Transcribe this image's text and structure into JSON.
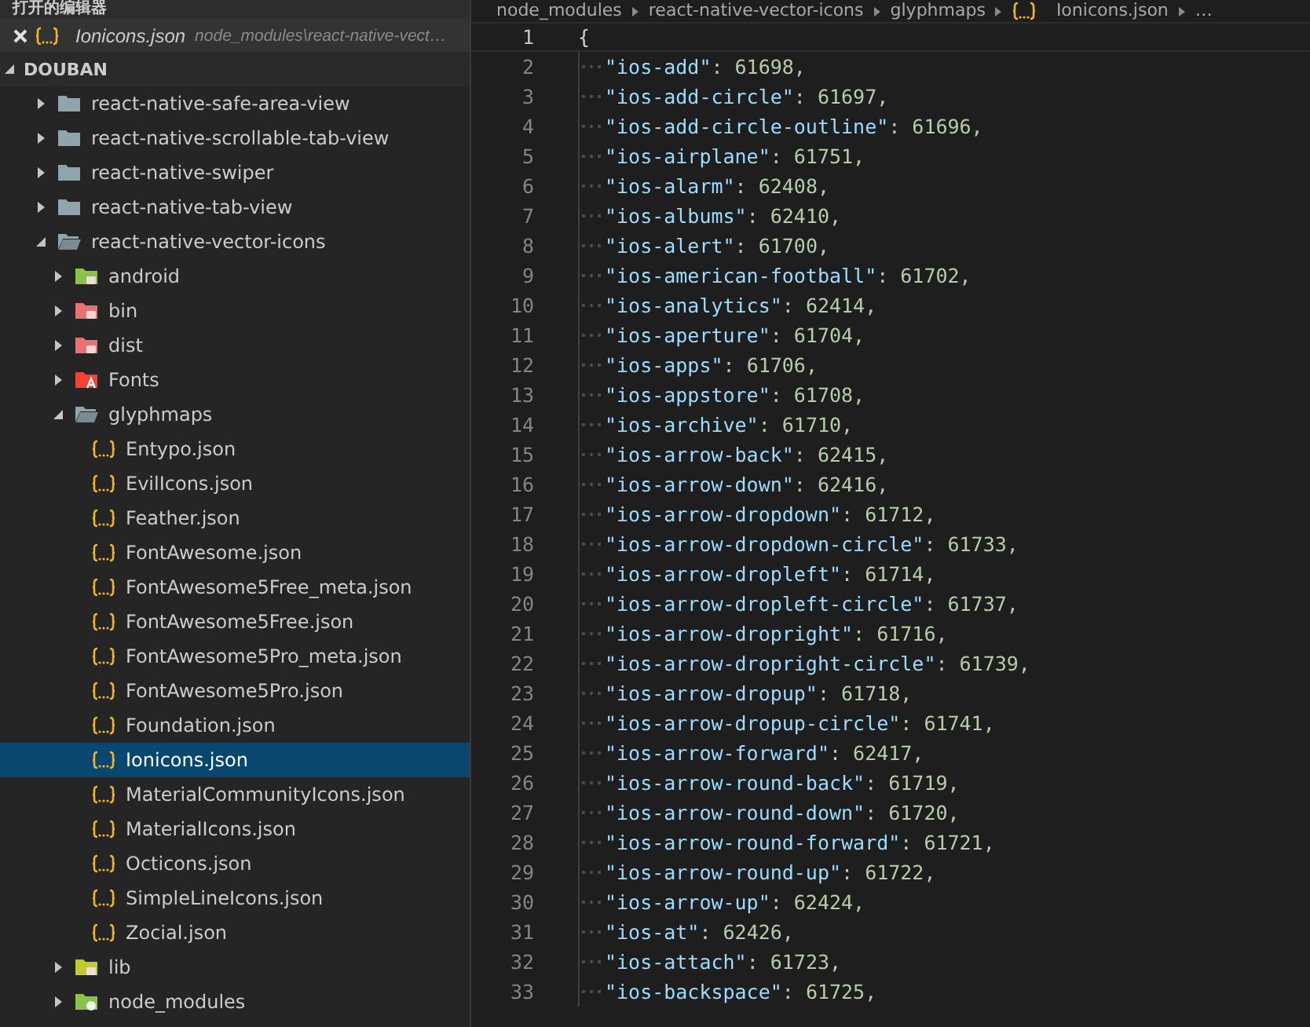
{
  "sidebar": {
    "open_editors_title": "打开的编辑器",
    "open_editors": [
      {
        "name": "Ionicons.json",
        "path": "node_modules\\react-native-vect…"
      }
    ],
    "project": "DOUBAN",
    "tree": [
      {
        "name": "react-native-safe-area-view",
        "kind": "folder",
        "expanded": false
      },
      {
        "name": "react-native-scrollable-tab-view",
        "kind": "folder",
        "expanded": false
      },
      {
        "name": "react-native-swiper",
        "kind": "folder",
        "expanded": false
      },
      {
        "name": "react-native-tab-view",
        "kind": "folder",
        "expanded": false
      },
      {
        "name": "react-native-vector-icons",
        "kind": "folder",
        "expanded": true,
        "children": [
          {
            "name": "android",
            "kind": "android",
            "expanded": false
          },
          {
            "name": "bin",
            "kind": "bin",
            "expanded": false
          },
          {
            "name": "dist",
            "kind": "dist",
            "expanded": false
          },
          {
            "name": "Fonts",
            "kind": "fonts",
            "expanded": false
          },
          {
            "name": "glyphmaps",
            "kind": "folder",
            "expanded": true,
            "children": [
              {
                "name": "Entypo.json",
                "kind": "json",
                "selected": false
              },
              {
                "name": "EvilIcons.json",
                "kind": "json",
                "selected": false
              },
              {
                "name": "Feather.json",
                "kind": "json",
                "selected": false
              },
              {
                "name": "FontAwesome.json",
                "kind": "json",
                "selected": false
              },
              {
                "name": "FontAwesome5Free_meta.json",
                "kind": "json",
                "selected": false
              },
              {
                "name": "FontAwesome5Free.json",
                "kind": "json",
                "selected": false
              },
              {
                "name": "FontAwesome5Pro_meta.json",
                "kind": "json",
                "selected": false
              },
              {
                "name": "FontAwesome5Pro.json",
                "kind": "json",
                "selected": false
              },
              {
                "name": "Foundation.json",
                "kind": "json",
                "selected": false
              },
              {
                "name": "Ionicons.json",
                "kind": "json",
                "selected": true
              },
              {
                "name": "MaterialCommunityIcons.json",
                "kind": "json",
                "selected": false
              },
              {
                "name": "MaterialIcons.json",
                "kind": "json",
                "selected": false
              },
              {
                "name": "Octicons.json",
                "kind": "json",
                "selected": false
              },
              {
                "name": "SimpleLineIcons.json",
                "kind": "json",
                "selected": false
              },
              {
                "name": "Zocial.json",
                "kind": "json",
                "selected": false
              }
            ]
          },
          {
            "name": "lib",
            "kind": "lib",
            "expanded": false
          },
          {
            "name": "node_modules",
            "kind": "node",
            "expanded": false
          }
        ]
      }
    ]
  },
  "breadcrumb": [
    "node_modules",
    "react-native-vector-icons",
    "glyphmaps",
    "Ionicons.json",
    "…"
  ],
  "editor": {
    "lines": [
      {
        "number": "1",
        "text": "{"
      },
      {
        "number": "2",
        "key": "\"ios-add\"",
        "value": ": 61698,"
      },
      {
        "number": "3",
        "key": "\"ios-add-circle\"",
        "value": ": 61697,"
      },
      {
        "number": "4",
        "key": "\"ios-add-circle-outline\"",
        "value": ": 61696,"
      },
      {
        "number": "5",
        "key": "\"ios-airplane\"",
        "value": ": 61751,"
      },
      {
        "number": "6",
        "key": "\"ios-alarm\"",
        "value": ": 62408,"
      },
      {
        "number": "7",
        "key": "\"ios-albums\"",
        "value": ": 62410,"
      },
      {
        "number": "8",
        "key": "\"ios-alert\"",
        "value": ": 61700,"
      },
      {
        "number": "9",
        "key": "\"ios-american-football\"",
        "value": ": 61702,"
      },
      {
        "number": "10",
        "key": "\"ios-analytics\"",
        "value": ": 62414,"
      },
      {
        "number": "11",
        "key": "\"ios-aperture\"",
        "value": ": 61704,"
      },
      {
        "number": "12",
        "key": "\"ios-apps\"",
        "value": ": 61706,"
      },
      {
        "number": "13",
        "key": "\"ios-appstore\"",
        "value": ": 61708,"
      },
      {
        "number": "14",
        "key": "\"ios-archive\"",
        "value": ": 61710,"
      },
      {
        "number": "15",
        "key": "\"ios-arrow-back\"",
        "value": ": 62415,"
      },
      {
        "number": "16",
        "key": "\"ios-arrow-down\"",
        "value": ": 62416,"
      },
      {
        "number": "17",
        "key": "\"ios-arrow-dropdown\"",
        "value": ": 61712,"
      },
      {
        "number": "18",
        "key": "\"ios-arrow-dropdown-circle\"",
        "value": ": 61733,"
      },
      {
        "number": "19",
        "key": "\"ios-arrow-dropleft\"",
        "value": ": 61714,"
      },
      {
        "number": "20",
        "key": "\"ios-arrow-dropleft-circle\"",
        "value": ": 61737,"
      },
      {
        "number": "21",
        "key": "\"ios-arrow-dropright\"",
        "value": ": 61716,"
      },
      {
        "number": "22",
        "key": "\"ios-arrow-dropright-circle\"",
        "value": ": 61739,"
      },
      {
        "number": "23",
        "key": "\"ios-arrow-dropup\"",
        "value": ": 61718,"
      },
      {
        "number": "24",
        "key": "\"ios-arrow-dropup-circle\"",
        "value": ": 61741,"
      },
      {
        "number": "25",
        "key": "\"ios-arrow-forward\"",
        "value": ": 62417,"
      },
      {
        "number": "26",
        "key": "\"ios-arrow-round-back\"",
        "value": ": 61719,"
      },
      {
        "number": "27",
        "key": "\"ios-arrow-round-down\"",
        "value": ": 61720,"
      },
      {
        "number": "28",
        "key": "\"ios-arrow-round-forward\"",
        "value": ": 61721,"
      },
      {
        "number": "29",
        "key": "\"ios-arrow-round-up\"",
        "value": ": 61722,"
      },
      {
        "number": "30",
        "key": "\"ios-arrow-up\"",
        "value": ": 62424,"
      },
      {
        "number": "31",
        "key": "\"ios-at\"",
        "value": ": 62426,"
      },
      {
        "number": "32",
        "key": "\"ios-attach\"",
        "value": ": 61723,"
      },
      {
        "number": "33",
        "key": "\"ios-backspace\"",
        "value": ": 61725,"
      }
    ]
  }
}
